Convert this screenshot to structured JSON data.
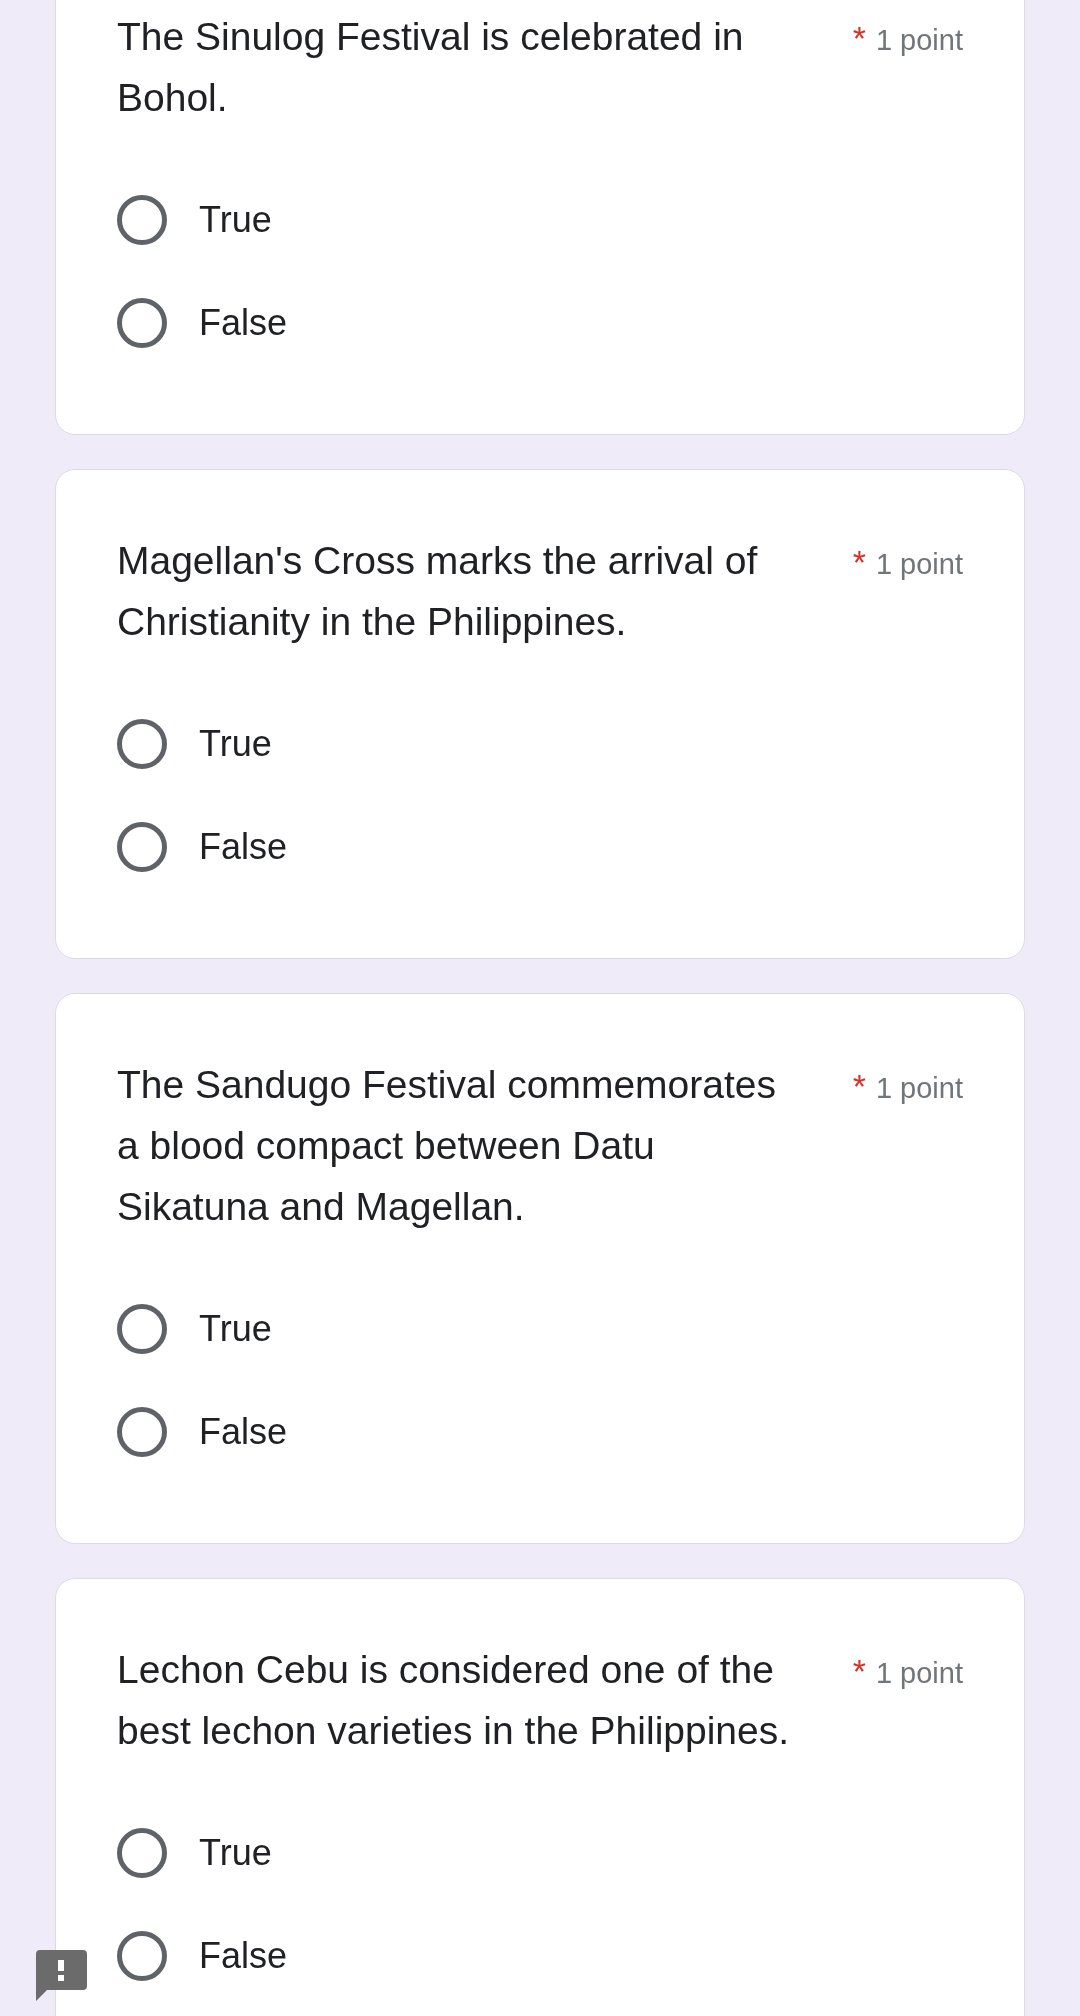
{
  "questions": [
    {
      "text": "The Sinulog Festival is celebrated in Bohol.",
      "required_mark": "*",
      "points": "1 point",
      "options": [
        {
          "label": "True",
          "selected": false
        },
        {
          "label": "False",
          "selected": false
        }
      ]
    },
    {
      "text": "Magellan's Cross marks the arrival of Christianity in the Philippines.",
      "required_mark": "*",
      "points": "1 point",
      "options": [
        {
          "label": "True",
          "selected": false
        },
        {
          "label": "False",
          "selected": false
        }
      ]
    },
    {
      "text": "The Sandugo Festival commemorates a blood compact between Datu Sikatuna and Magellan.",
      "required_mark": "*",
      "points": "1 point",
      "options": [
        {
          "label": "True",
          "selected": false
        },
        {
          "label": "False",
          "selected": false
        }
      ]
    },
    {
      "text": "Lechon Cebu is considered one of the best lechon varieties in the Philippines.",
      "required_mark": "*",
      "points": "1 point",
      "options": [
        {
          "label": "True",
          "selected": false
        },
        {
          "label": "False",
          "selected": false
        }
      ]
    }
  ]
}
